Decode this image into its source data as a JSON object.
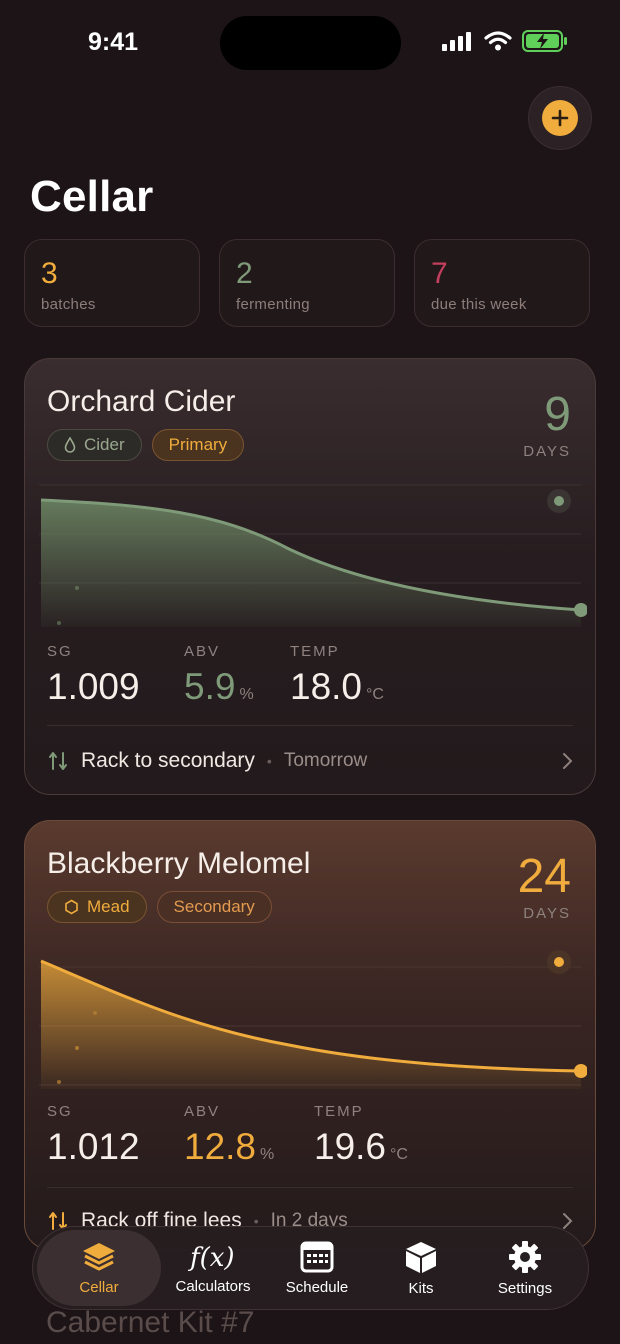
{
  "status": {
    "time": "9:41"
  },
  "header": {
    "title": "Cellar"
  },
  "stats": [
    {
      "value": "3",
      "label": "batches",
      "color": "#f0ac3c"
    },
    {
      "value": "2",
      "label": "fermenting",
      "color": "#7f9a78"
    },
    {
      "value": "7",
      "label": "due this week",
      "color": "#c23f5e"
    }
  ],
  "batches": [
    {
      "name": "Orchard Cider",
      "days": "9",
      "days_label": "DAYS",
      "type_tag": "Cider",
      "stage_tag": "Primary",
      "metrics": {
        "sg_label": "SG",
        "sg": "1.009",
        "abv_label": "ABV",
        "abv": "5.9",
        "abv_unit": "%",
        "temp_label": "TEMP",
        "temp": "18.0",
        "temp_unit": "°C"
      },
      "task": "Rack to secondary",
      "task_when": "Tomorrow",
      "accent": "#7f9a78"
    },
    {
      "name": "Blackberry Melomel",
      "days": "24",
      "days_label": "DAYS",
      "type_tag": "Mead",
      "stage_tag": "Secondary",
      "metrics": {
        "sg_label": "SG",
        "sg": "1.012",
        "abv_label": "ABV",
        "abv": "12.8",
        "abv_unit": "%",
        "temp_label": "TEMP",
        "temp": "19.6",
        "temp_unit": "°C"
      },
      "task": "Rack off fine lees",
      "task_when": "In 2 days",
      "accent": "#f0ac3c"
    }
  ],
  "peek_card": {
    "name": "Cabernet Kit #7"
  },
  "tabs": [
    {
      "label": "Cellar",
      "icon": "layers-icon",
      "active": true
    },
    {
      "label": "Calculators",
      "icon": "function-icon"
    },
    {
      "label": "Schedule",
      "icon": "calendar-icon"
    },
    {
      "label": "Kits",
      "icon": "box-icon"
    },
    {
      "label": "Settings",
      "icon": "gear-icon"
    }
  ]
}
